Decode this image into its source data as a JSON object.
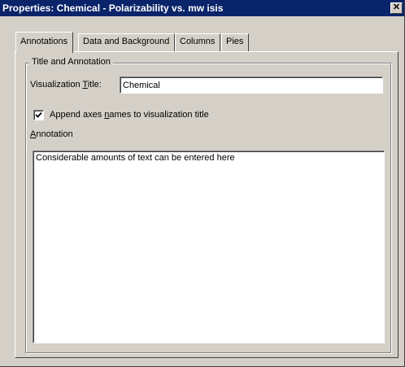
{
  "window": {
    "title": "Properties: Chemical - Polarizability vs. mw isis",
    "close_glyph": "✕"
  },
  "tabs": [
    {
      "label": "Annotations",
      "active": true
    },
    {
      "label": "Data and Background",
      "active": false
    },
    {
      "label": "Columns",
      "active": false
    },
    {
      "label": "Pies",
      "active": false
    }
  ],
  "group": {
    "legend": "Title and Annotation"
  },
  "viz_title": {
    "label_pre": "Visualization ",
    "label_accel": "T",
    "label_post": "itle:",
    "value": "Chemical"
  },
  "append_axes": {
    "checked": true,
    "label_pre": "Append axes ",
    "label_accel": "n",
    "label_post": "ames to visualization title"
  },
  "annotation": {
    "label_accel": "A",
    "label_post": "nnotation",
    "value": "Considerable amounts of text can be entered here"
  }
}
